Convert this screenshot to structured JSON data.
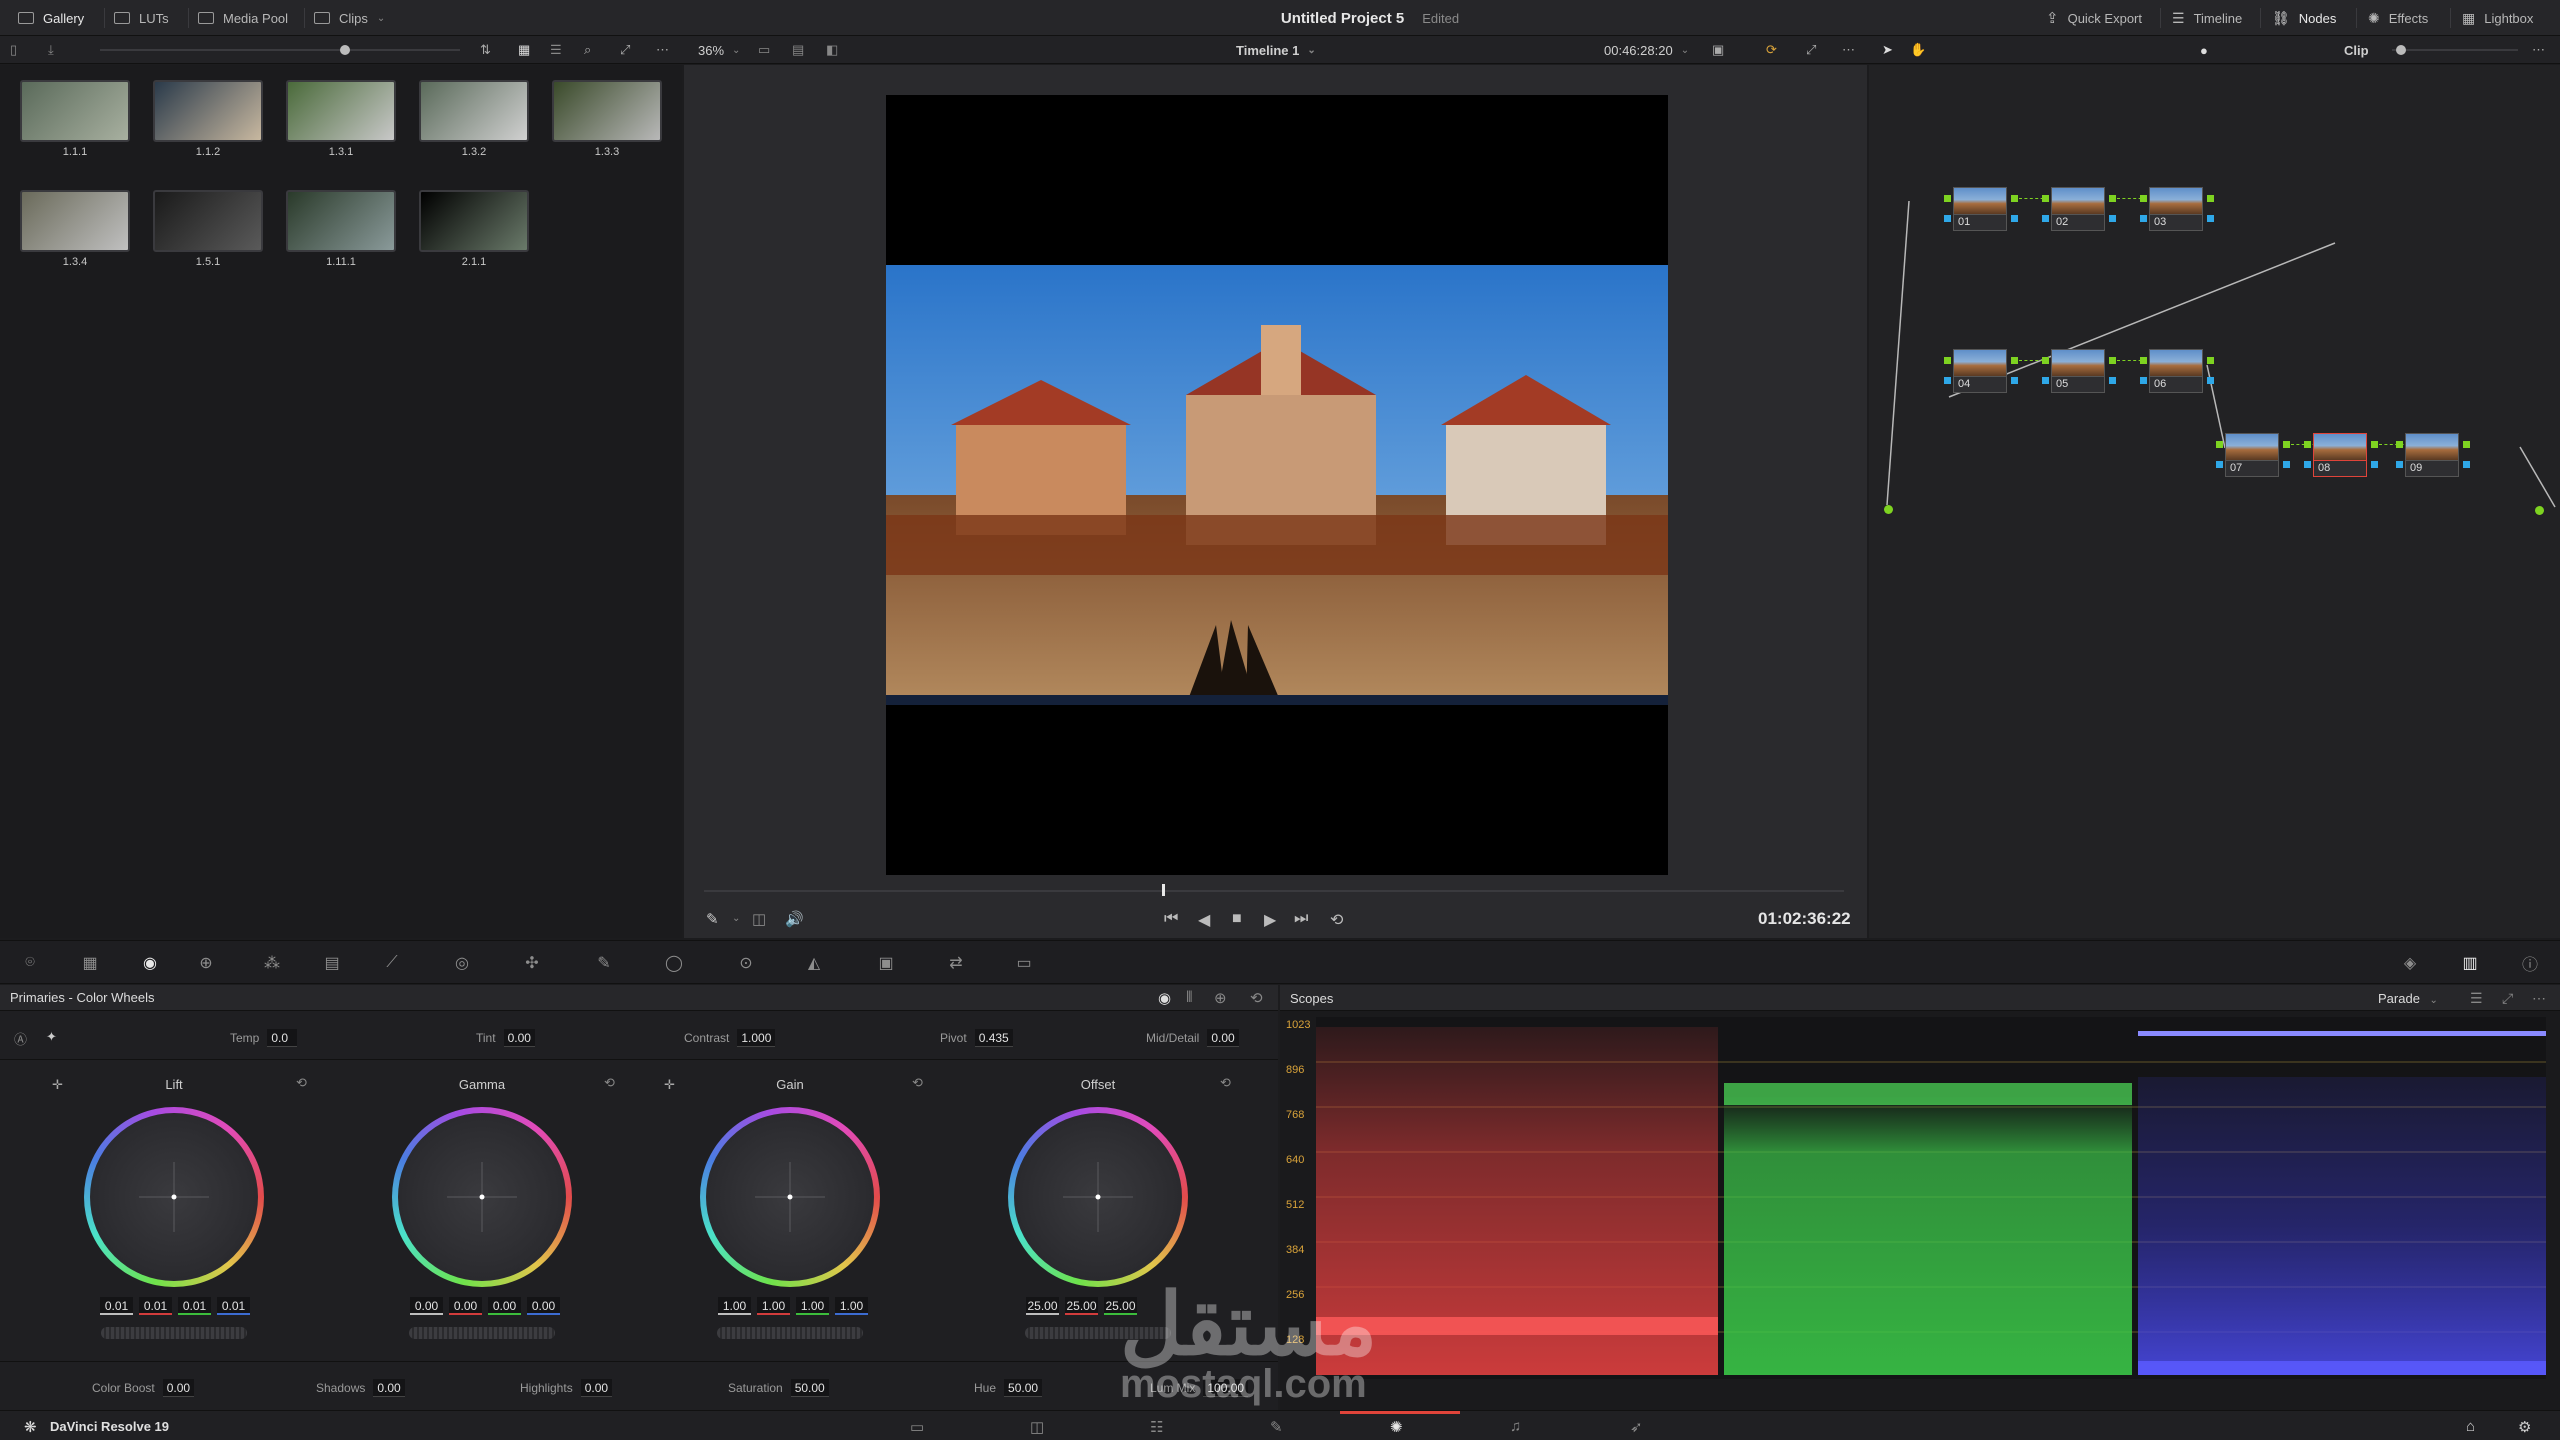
{
  "topbar": {
    "gallery": "Gallery",
    "luts": "LUTs",
    "media_pool": "Media Pool",
    "clips": "Clips",
    "project_title": "Untitled Project 5",
    "edited": "Edited",
    "quick_export": "Quick Export",
    "timeline": "Timeline",
    "nodes": "Nodes",
    "effects": "Effects",
    "lightbox": "Lightbox"
  },
  "toolbar": {
    "zoom": "36%",
    "timeline_name": "Timeline 1",
    "timecode": "00:46:28:20",
    "clip_mode": "Clip"
  },
  "gallery": {
    "stills": [
      {
        "label": "1.1.1"
      },
      {
        "label": "1.1.2"
      },
      {
        "label": "1.3.1"
      },
      {
        "label": "1.3.2"
      },
      {
        "label": "1.3.3"
      },
      {
        "label": "1.3.4"
      },
      {
        "label": "1.5.1"
      },
      {
        "label": "1.11.1"
      },
      {
        "label": "2.1.1"
      }
    ]
  },
  "viewer": {
    "playhead_timecode": "01:02:36:22"
  },
  "nodes": [
    {
      "label": "01"
    },
    {
      "label": "02"
    },
    {
      "label": "03"
    },
    {
      "label": "04"
    },
    {
      "label": "05"
    },
    {
      "label": "06"
    },
    {
      "label": "07"
    },
    {
      "label": "08"
    },
    {
      "label": "09"
    }
  ],
  "primaries": {
    "title": "Primaries - Color Wheels",
    "temp_label": "Temp",
    "temp": "0.0",
    "tint_label": "Tint",
    "tint": "0.00",
    "contrast_label": "Contrast",
    "contrast": "1.000",
    "pivot_label": "Pivot",
    "pivot": "0.435",
    "middetail_label": "Mid/Detail",
    "middetail": "0.00",
    "wheels": [
      {
        "name": "Lift",
        "values": [
          "0.01",
          "0.01",
          "0.01",
          "0.01"
        ]
      },
      {
        "name": "Gamma",
        "values": [
          "0.00",
          "0.00",
          "0.00",
          "0.00"
        ]
      },
      {
        "name": "Gain",
        "values": [
          "1.00",
          "1.00",
          "1.00",
          "1.00"
        ]
      },
      {
        "name": "Offset",
        "values": [
          "25.00",
          "25.00",
          "25.00"
        ]
      }
    ],
    "color_boost_label": "Color Boost",
    "color_boost": "0.00",
    "shadows_label": "Shadows",
    "shadows": "0.00",
    "highlights_label": "Highlights",
    "highlights": "0.00",
    "saturation_label": "Saturation",
    "saturation": "50.00",
    "hue_label": "Hue",
    "hue": "50.00",
    "lum_mix_label": "Lum Mix",
    "lum_mix": "100.00"
  },
  "scopes": {
    "title": "Scopes",
    "mode": "Parade",
    "scale": [
      "1023",
      "896",
      "768",
      "640",
      "512",
      "384",
      "256",
      "128"
    ]
  },
  "statusbar": {
    "app_name": "DaVinci Resolve 19"
  },
  "watermark": {
    "arabic": "مستقل",
    "domain": "mostaql.com"
  },
  "colors": {
    "accent": "#e0443a",
    "node_connector_green": "#7ed321",
    "node_connector_blue": "#2fa8e8"
  }
}
